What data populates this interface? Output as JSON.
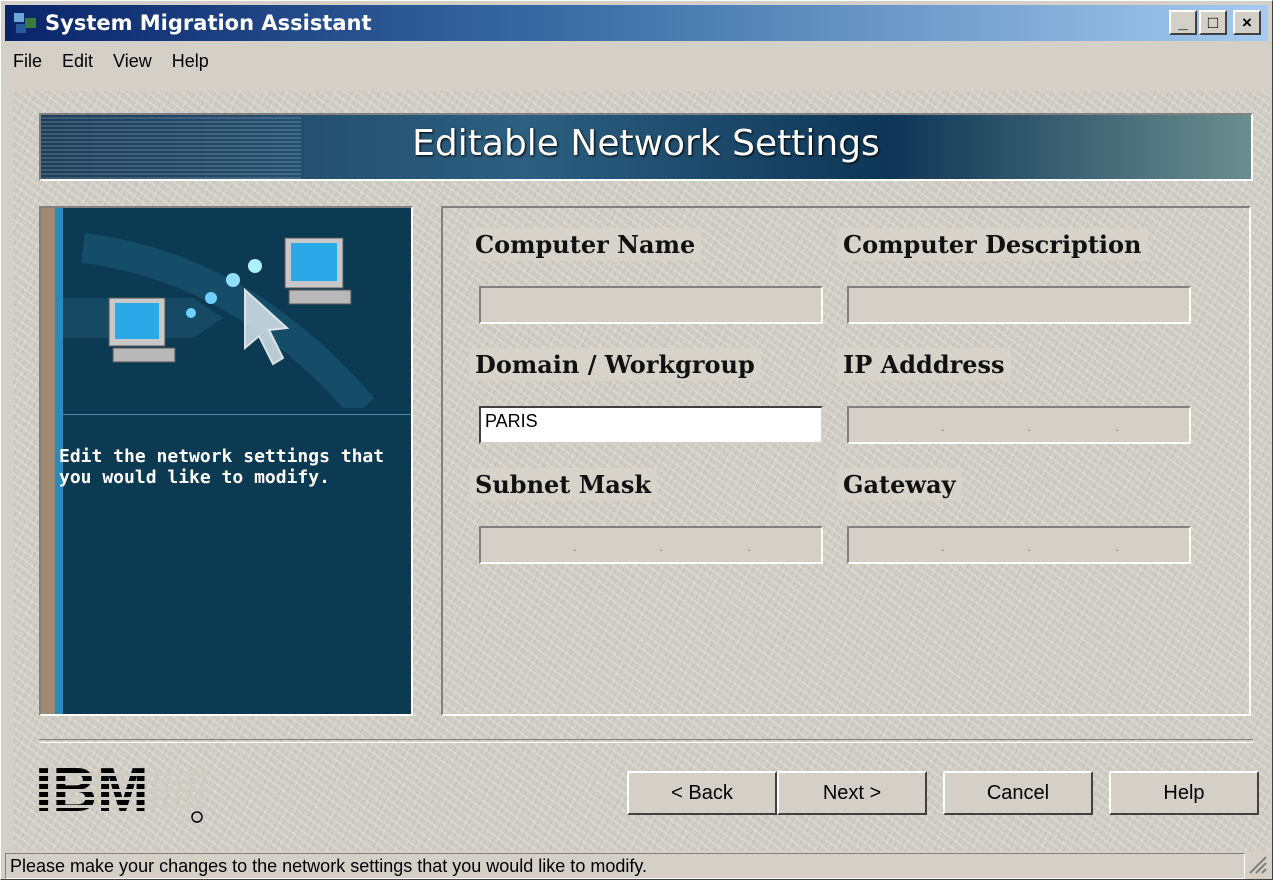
{
  "window": {
    "title": "System Migration Assistant",
    "controls": {
      "minimize": "_",
      "maximize": "□",
      "close": "×"
    }
  },
  "menu": {
    "items": [
      "File",
      "Edit",
      "View",
      "Help"
    ]
  },
  "header": {
    "title": "Editable Network Settings"
  },
  "left_panel": {
    "description": "Edit the network settings that you would like to modify."
  },
  "fields": {
    "computer_name": {
      "label": "Computer Name",
      "value": ""
    },
    "computer_description": {
      "label": "Computer Description",
      "value": ""
    },
    "domain_workgroup": {
      "label": "Domain / Workgroup",
      "value": "PARIS"
    },
    "ip_address": {
      "label": "IP Adddress",
      "value": ""
    },
    "subnet_mask": {
      "label": "Subnet Mask",
      "value": ""
    },
    "gateway": {
      "label": "Gateway",
      "value": ""
    }
  },
  "buttons": {
    "back": "< Back",
    "next": "Next >",
    "cancel": "Cancel",
    "help": "Help"
  },
  "status_bar": {
    "text": "Please make your changes to the network settings that you would like to modify."
  },
  "logo": {
    "text": "IBM"
  },
  "colors": {
    "title_bar": "#0a246a",
    "left_panel": "#0b3a52",
    "face": "#d4d0c8"
  }
}
